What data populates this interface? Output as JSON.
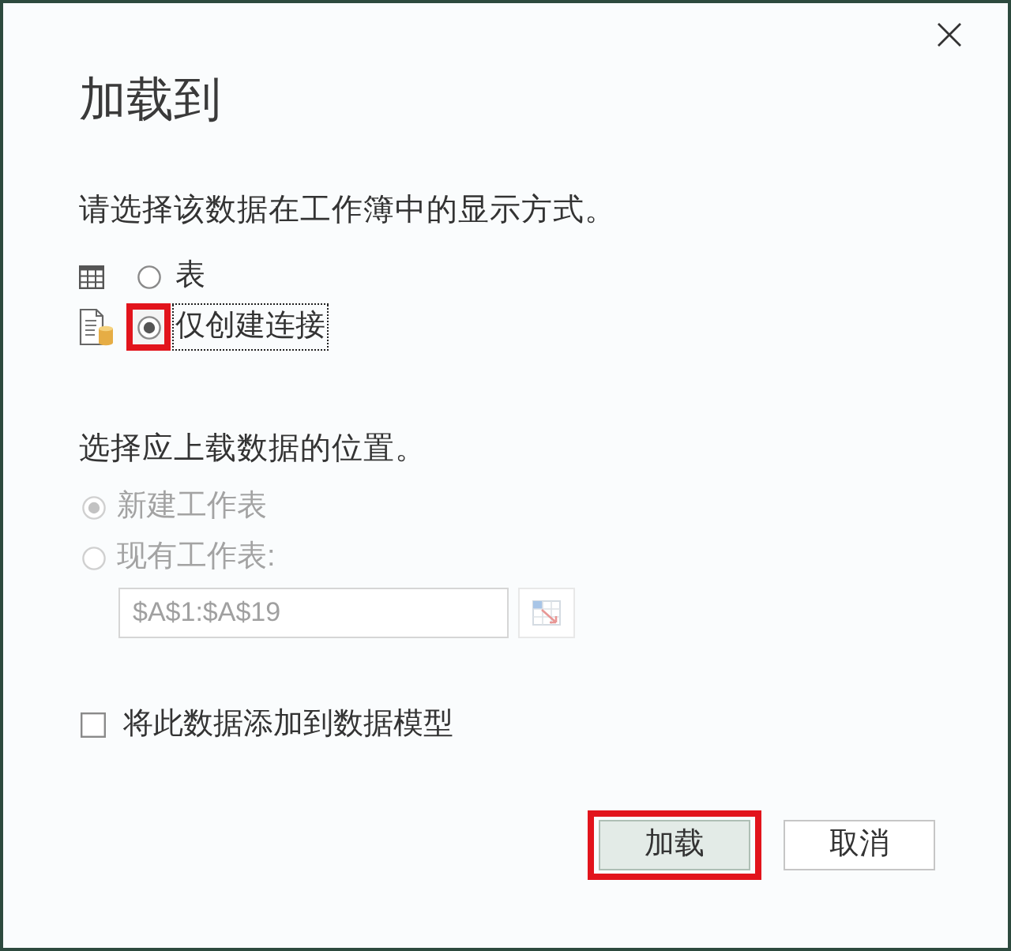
{
  "window": {
    "title": "加载到"
  },
  "display_section": {
    "prompt": "请选择该数据在工作簿中的显示方式。",
    "options": [
      {
        "kind": "table",
        "label": "表",
        "selected": false,
        "highlighted": false,
        "focused": false
      },
      {
        "kind": "connection",
        "label": "仅创建连接",
        "selected": true,
        "highlighted": true,
        "focused": true
      }
    ]
  },
  "location_section": {
    "prompt": "选择应上载数据的位置。",
    "disabled": true,
    "options": [
      {
        "label": "新建工作表",
        "selected": true
      },
      {
        "label": "现有工作表:",
        "selected": false
      }
    ],
    "range_field": {
      "value": "$A$1:$A$19"
    }
  },
  "data_model_checkbox": {
    "label": "将此数据添加到数据模型",
    "checked": false
  },
  "buttons": [
    {
      "kind": "primary",
      "label": "加载",
      "highlighted": true
    },
    {
      "kind": "secondary",
      "label": "取消",
      "highlighted": false
    }
  ]
}
